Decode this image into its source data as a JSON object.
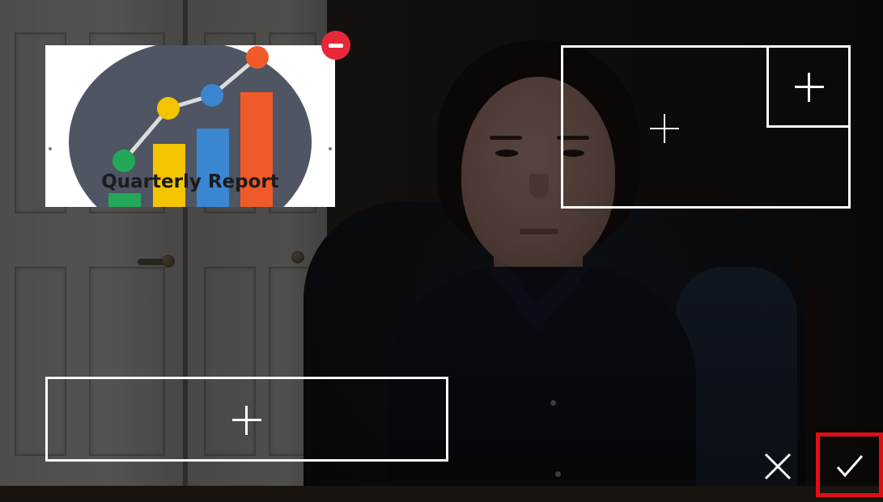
{
  "overlay_image": {
    "title": "Quarterly Report",
    "icon": "chart-graphic-icon"
  },
  "controls": {
    "remove_icon": "minus-circle-icon",
    "cancel_icon": "close-icon",
    "confirm_icon": "check-icon",
    "add_icon": "plus-icon"
  },
  "colors": {
    "remove": "#e8283a",
    "highlight": "#e00e14",
    "chart_green": "#23a85a",
    "chart_yellow": "#f5c400",
    "chart_blue": "#3a86d0",
    "chart_orange": "#f05a28",
    "chart_bg": "#4f5563"
  }
}
